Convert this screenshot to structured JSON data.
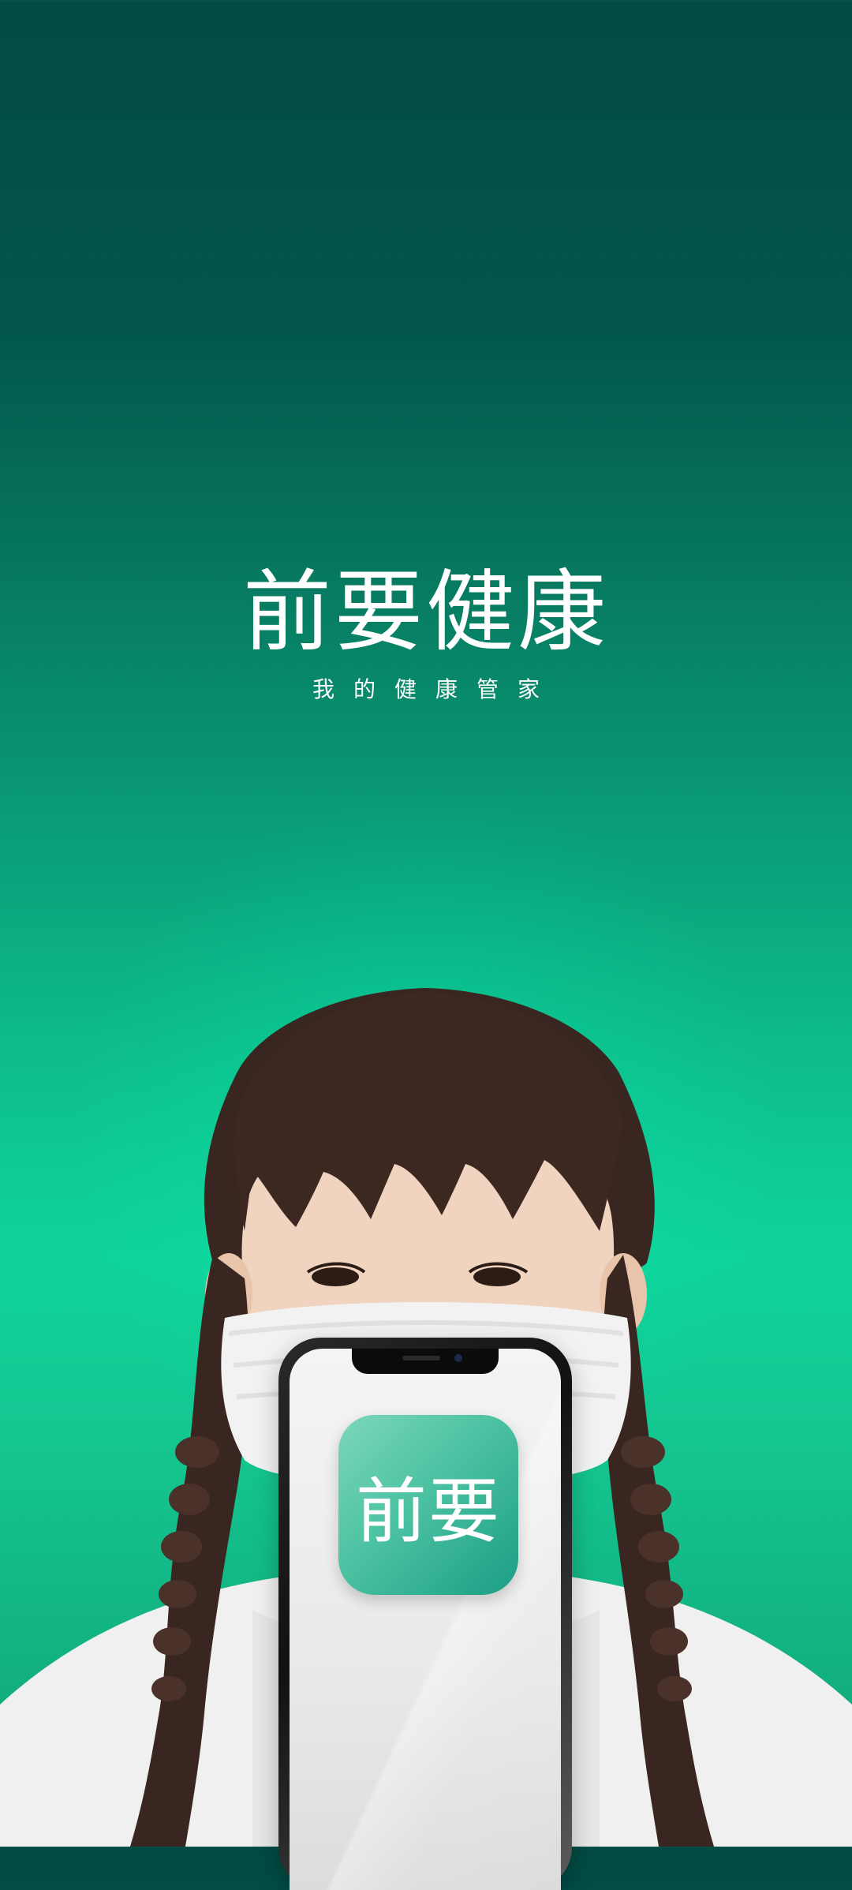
{
  "splash": {
    "brand_title": "前要健康",
    "brand_subtitle": "我的健康管家",
    "app_icon_label": "前要"
  },
  "colors": {
    "background_top": "#024a43",
    "background_mid": "#0fd39a",
    "text": "#ffffff",
    "app_icon": "#4cc2a2"
  }
}
